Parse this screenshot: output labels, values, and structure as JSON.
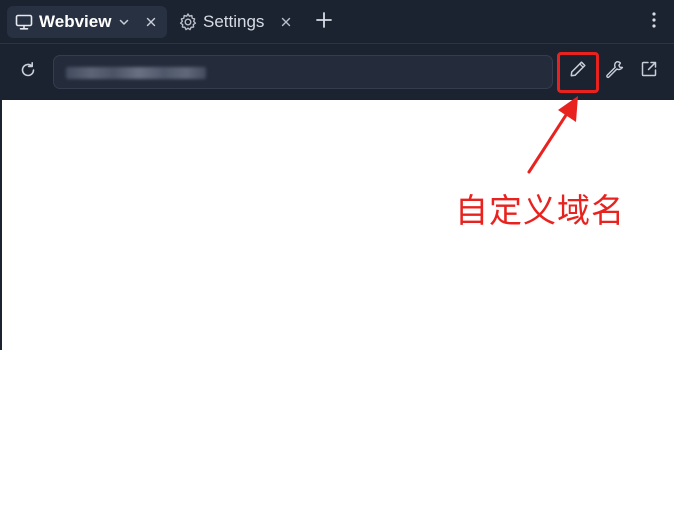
{
  "tabs": [
    {
      "label": "Webview",
      "icon": "monitor-icon",
      "active": true
    },
    {
      "label": "Settings",
      "icon": "gear-icon",
      "active": false
    }
  ],
  "toolbar": {
    "reload_icon": "reload-icon",
    "edit_icon": "pencil-icon",
    "devtools_icon": "wrench-icon",
    "external_icon": "external-link-icon"
  },
  "annotation": {
    "text": "自定义域名",
    "color": "#e8231f"
  },
  "colors": {
    "chrome_bg": "#1b2230",
    "active_tab_bg": "#283141",
    "url_bg": "#242c3b",
    "content_bg": "#ffffff",
    "highlight": "#e8231f"
  }
}
